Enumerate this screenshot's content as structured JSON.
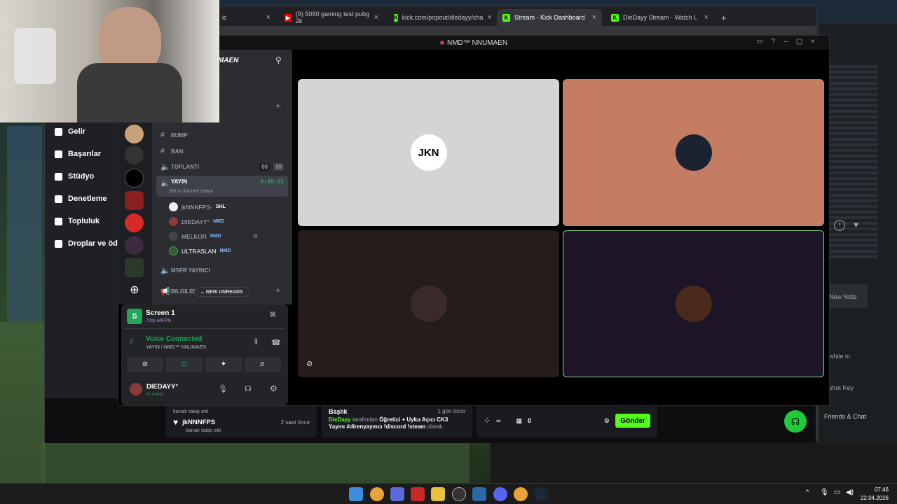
{
  "browser": {
    "tabs": [
      {
        "label": "ic",
        "favicon": ""
      },
      {
        "label": "(9) 5090 gaming test pubg 2k",
        "favicon": "youtube-icon"
      },
      {
        "label": "kick.com/popout/diedayy/cha",
        "favicon": "kick-icon"
      },
      {
        "label": "Stream - Kick Dashboard",
        "favicon": "kick-icon"
      },
      {
        "label": "DieDayy Stream - Watch L",
        "favicon": "kick-icon"
      }
    ]
  },
  "kick_nav": {
    "items": [
      "Gelir",
      "Başarılar",
      "Stüdyo",
      "Denetleme",
      "Topluluk",
      "Droplar ve öd"
    ]
  },
  "kick_bottom": {
    "follow_prev_text": "kanalı takip etti",
    "follow_user": "jkNNNFPS",
    "follow_time": "2 saat önce",
    "follow_text": "kanalı takip etti",
    "title_label": "Başlık",
    "title_time": "1 gün önce",
    "title_user": "DieDayy",
    "title_by": "tarafından",
    "title_value": "Öğretici + Uyku Açıcı CK3 Yayını #direnyayıncı !discord !steam",
    "title_suffix": "olarak",
    "viewers_symbol": "∞",
    "count_value": "0",
    "send_label": "Gönder"
  },
  "right_window": {
    "new_note": "New Note",
    "while_in": "while in",
    "shot_key": "shot Key",
    "friends_chat": "Friends & Chat"
  },
  "discord": {
    "window_title": "NMD™ NNUMAEN",
    "server_name": "MAEN",
    "channels": [
      {
        "name": "BUMP",
        "type": "text"
      },
      {
        "name": "BAN",
        "type": "text"
      },
      {
        "name": "TOPLANTI",
        "type": "voice",
        "badge_a": "00",
        "badge_b": "99"
      },
      {
        "name": "YAYIN",
        "type": "voice",
        "timer": "4:40:03",
        "status": "Set a channel status"
      },
      {
        "name": "MSFR YAYINCI",
        "type": "voice"
      },
      {
        "name": "BILGILEN",
        "type": "announce"
      }
    ],
    "voice_users": [
      {
        "name": "jkNNNFPS-",
        "tag": "SHL"
      },
      {
        "name": "DIEDAYY°",
        "tag": "NMD"
      },
      {
        "name": "MELKOR",
        "tag": "NMD"
      },
      {
        "name": "ULTRASLAN",
        "tag": "NMD"
      }
    ],
    "new_unreads": "NEW UNREADS",
    "screen_share": {
      "title": "Screen 1",
      "quality": "720p 60FPS"
    },
    "voice_connected": {
      "label": "Voice Connected",
      "channel": "YAYIN / NMD™ NNUMAEN"
    },
    "self_user": {
      "name": "DIEDAYY°",
      "status": "In voice"
    },
    "tiles": [
      {
        "bg": "#d4d4d4"
      },
      {
        "bg": "#c47c62"
      },
      {
        "bg": "#241d1b"
      },
      {
        "bg": "#1e1428"
      }
    ]
  },
  "taskbar": {
    "time": "07:46",
    "date": "22.04.2026"
  }
}
